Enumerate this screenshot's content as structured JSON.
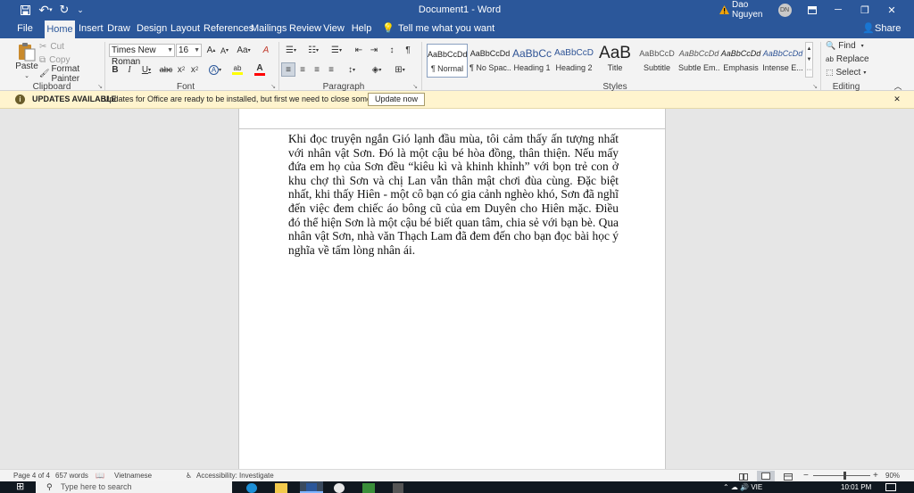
{
  "window": {
    "doc_title": "Document1",
    "separator": "-",
    "app_name": "Word",
    "user_name": "Dao Nguyen",
    "user_initials": "DN",
    "minimize_glyph": "─",
    "maximize_glyph": "❐",
    "close_glyph": "✕"
  },
  "quick_access": {
    "save_glyph": "💾",
    "undo_glyph": "↶",
    "redo_glyph": "↻",
    "customize_glyph": "⌄"
  },
  "tabs": [
    "File",
    "Home",
    "Insert",
    "Draw",
    "Design",
    "Layout",
    "References",
    "Mailings",
    "Review",
    "View",
    "Help"
  ],
  "active_tab": "Home",
  "tell_me": {
    "icon_glyph": "💡",
    "placeholder": "Tell me what you want to do"
  },
  "share": {
    "label": "Share",
    "icon_glyph": "👤"
  },
  "clipboard": {
    "paste_label": "Paste",
    "paste_arrow": "⌄",
    "cut_label": "Cut",
    "cut_glyph": "✂",
    "copy_label": "Copy",
    "copy_glyph": "⧉",
    "format_painter_label": "Format Painter",
    "format_painter_glyph": "🖌",
    "group_label": "Clipboard"
  },
  "font": {
    "name": "Times New Roman",
    "size": "16",
    "grow_glyph": "A",
    "shrink_glyph": "A",
    "case_glyph": "Aa",
    "clear_glyph": "A",
    "bold_glyph": "B",
    "italic_glyph": "I",
    "underline_glyph": "U",
    "strike_glyph": "abc",
    "subscript_glyph": "x",
    "superscript_glyph": "x",
    "effects_glyph": "A",
    "highlight_glyph": "ab",
    "color_glyph": "A",
    "highlight_color": "#ffff00",
    "font_color": "#ff0000",
    "group_label": "Font"
  },
  "paragraph": {
    "bullets_glyph": "☰",
    "numbering_glyph": "☷",
    "multilevel_glyph": "☰",
    "decrease_indent_glyph": "⇤",
    "increase_indent_glyph": "⇥",
    "sort_glyph": "↕",
    "pilcrow_glyph": "¶",
    "align_left_glyph": "≡",
    "center_glyph": "≡",
    "align_right_glyph": "≡",
    "justify_glyph": "≡",
    "line_spacing_glyph": "↕",
    "shading_glyph": "◈",
    "borders_glyph": "⊞",
    "group_label": "Paragraph"
  },
  "styles": {
    "items": [
      {
        "preview": "AaBbCcDd",
        "name": "¶ Normal"
      },
      {
        "preview": "AaBbCcDd",
        "name": "¶ No Spac..."
      },
      {
        "preview": "AaBbCc",
        "name": "Heading 1"
      },
      {
        "preview": "AaBbCcD",
        "name": "Heading 2"
      },
      {
        "preview": "AaB",
        "name": "Title"
      },
      {
        "preview": "AaBbCcD",
        "name": "Subtitle"
      },
      {
        "preview": "AaBbCcDd",
        "name": "Subtle Em..."
      },
      {
        "preview": "AaBbCcDd",
        "name": "Emphasis"
      },
      {
        "preview": "AaBbCcDd",
        "name": "Intense E..."
      }
    ],
    "group_label": "Styles"
  },
  "editing": {
    "find_label": "Find",
    "find_glyph": "🔍",
    "replace_label": "Replace",
    "replace_glyph": "ab",
    "select_label": "Select",
    "select_glyph": "⬚",
    "group_label": "Editing"
  },
  "ribbon_collapse_glyph": "︿",
  "dialog_launcher_glyph": "↘",
  "notification": {
    "icon_glyph": "i",
    "title": "UPDATES AVAILABLE",
    "message": "Updates for Office are ready to be installed, but first we need to close some apps.",
    "button_label": "Update now",
    "close_glyph": "✕"
  },
  "document": {
    "paragraph": "Khi đọc truyện ngắn Gió lạnh đầu mùa, tôi cảm thấy ấn tượng nhất với nhân vật Sơn. Đó là một cậu bé hòa đồng, thân thiện. Nếu mấy đứa em họ của Sơn đều “kiêu kì và khinh khỉnh” với bọn trẻ con ở khu chợ thì Sơn và chị Lan vẫn thân mật chơi đùa cùng. Đặc biệt nhất, khi thấy Hiên - một cô bạn có gia cảnh nghèo khó, Sơn đã nghĩ đến việc đem chiếc áo bông cũ của em Duyên cho Hiên mặc. Điều đó thể hiện Sơn là một cậu bé biết quan tâm, chia sẻ với bạn bè. Qua nhân vật Sơn, nhà văn Thạch Lam đã đem đến cho bạn đọc bài học ý nghĩa về tấm lòng nhân ái."
  },
  "status": {
    "page": "Page 4 of 4",
    "words": "657 words",
    "proofing_glyph": "📖",
    "language": "Vietnamese",
    "accessibility_glyph": "♿",
    "accessibility": "Accessibility: Investigate",
    "zoom_minus": "−",
    "zoom_plus": "+",
    "zoom_level": "90%",
    "zoom_fraction": 0.55
  },
  "taskbar": {
    "start_glyph": "⊞",
    "search_glyph": "⚲",
    "search_placeholder": "Type here to search",
    "apps": [
      "edge",
      "explorer",
      "word",
      "zoom",
      "chrome",
      "calculator"
    ],
    "tray_glyphs": "⌃  ☁  🔊  VIE",
    "time": "10:01 PM"
  },
  "colors": {
    "accent": "#2b579a",
    "notification_bg": "#fff4ce",
    "warning": "#f0a30a"
  }
}
